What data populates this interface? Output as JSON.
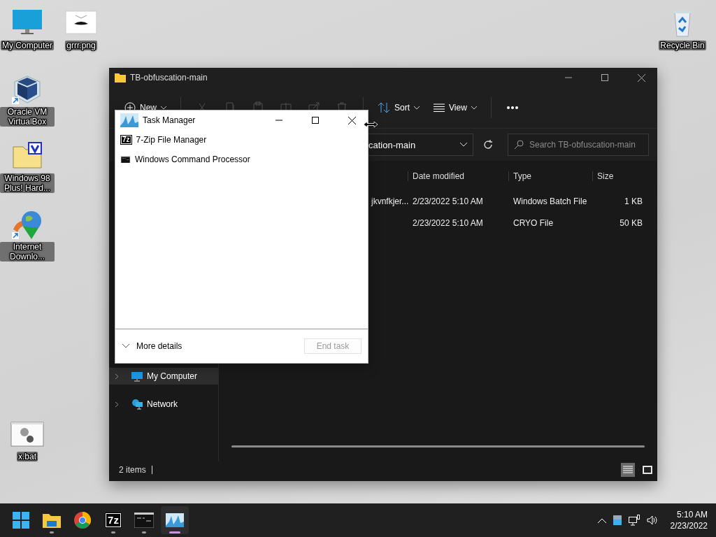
{
  "desktop_icons": [
    {
      "label": "My Computer",
      "kind": "monitor"
    },
    {
      "label": "grrr.png",
      "kind": "image"
    },
    {
      "label": "Oracle VM VirtualBox",
      "kind": "cube",
      "shortcut": true
    },
    {
      "label": "Windows 98 Plus! Hard...",
      "kind": "folder"
    },
    {
      "label": "Internet Downlo...",
      "kind": "globe",
      "shortcut": true
    },
    {
      "label": "x.bat",
      "kind": "batch"
    },
    {
      "label": "Recycle Bin",
      "kind": "bin"
    }
  ],
  "explorer": {
    "title": "TB-obfuscation-main",
    "toolbar": {
      "new": "New",
      "actions": [
        {
          "kind": "cut",
          "disabled": true
        },
        {
          "kind": "copy",
          "disabled": true
        },
        {
          "kind": "paste",
          "disabled": true
        },
        {
          "kind": "rename",
          "disabled": true
        },
        {
          "kind": "share",
          "disabled": true
        },
        {
          "kind": "delete",
          "disabled": true
        }
      ],
      "sort": "Sort",
      "view": "View"
    },
    "address": "cation-main",
    "search": {
      "placeholder": "Search TB-obfuscation-main"
    },
    "columns": [
      "Date modified",
      "Type",
      "Size"
    ],
    "rows": [
      {
        "name": "jkvnfkjer...",
        "date": "2/23/2022 5:10 AM",
        "type": "Windows Batch File",
        "size": "1 KB"
      },
      {
        "date": "2/23/2022 5:10 AM",
        "type": "CRYO File",
        "size": "50 KB"
      }
    ],
    "nav": [
      {
        "label": "My Computer",
        "kind": "computer",
        "selected": true
      },
      {
        "label": "Network",
        "kind": "network",
        "selected": false
      }
    ],
    "status": "2 items",
    "views": [
      {
        "kind": "details",
        "selected": true
      },
      {
        "kind": "tiles",
        "selected": false
      }
    ]
  },
  "task_manager": {
    "title": "Task Manager",
    "apps": [
      {
        "name": "7-Zip File Manager",
        "kind": "sevenzip",
        "logo_text": "7z"
      },
      {
        "name": "Windows Command Processor",
        "kind": "cmd"
      }
    ],
    "more_details": "More details",
    "end_task": {
      "label": "End task",
      "disabled": true
    }
  },
  "taskbar": {
    "apps": [
      {
        "kind": "start",
        "running": false,
        "selected": false
      },
      {
        "kind": "folder",
        "running": true,
        "selected": false
      },
      {
        "kind": "chrome",
        "running": false,
        "selected": false
      },
      {
        "kind": "sevenzip",
        "logo_text": "7z",
        "running": true,
        "selected": false
      },
      {
        "kind": "cmd",
        "running": true,
        "selected": false
      },
      {
        "kind": "taskmgr",
        "running": true,
        "selected": true
      }
    ],
    "clock": {
      "time": "5:10 AM",
      "date": "2/23/2022"
    }
  }
}
